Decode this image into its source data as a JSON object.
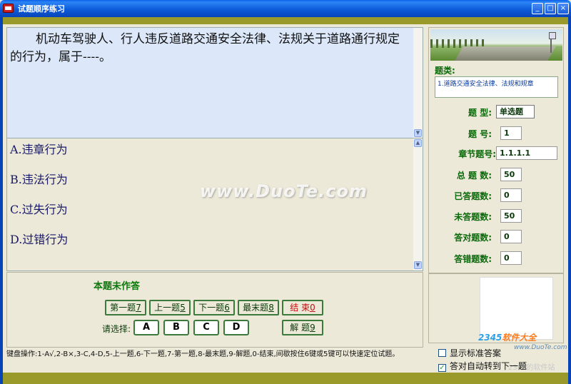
{
  "window": {
    "title": "试题顺序练习"
  },
  "question": {
    "text": "机动车驾驶人、行人违反道路交通安全法律、法规关于道路通行规定的行为，属于----。"
  },
  "options": [
    {
      "label": "A.违章行为"
    },
    {
      "label": "B.违法行为"
    },
    {
      "label": "C.过失行为"
    },
    {
      "label": "D.过错行为"
    }
  ],
  "watermark": "www.DuoTe.com",
  "controls": {
    "status": "本题未作答",
    "first": {
      "label": "第一题",
      "key": "7"
    },
    "prev": {
      "label": "上一题",
      "key": "5"
    },
    "next": {
      "label": "下一题",
      "key": "6"
    },
    "last": {
      "label": "最末题",
      "key": "8"
    },
    "end": {
      "label": "结  束",
      "key": "0"
    },
    "select_label": "请选择:",
    "choices": [
      "A",
      "B",
      "C",
      "D"
    ],
    "solve": {
      "label": "解  题",
      "key": "9"
    }
  },
  "help_text": "键盘操作:1-A√,2-B×,3-C,4-D,5-上一题,6-下一题,7-第一题,8-最末题,9-解题,0-结束,间歇按住6键或5键可以快速定位试题。",
  "info": {
    "category_label": "题类:",
    "category_value": "1.道路交通安全法律、法规和规章",
    "fields": [
      {
        "label": "题  型:",
        "value": "单选题"
      },
      {
        "label": "题  号:",
        "value": "1"
      },
      {
        "label": "章节题号:",
        "value": "1.1.1.1"
      },
      {
        "label": "总 题 数:",
        "value": "50"
      },
      {
        "label": "已答题数:",
        "value": "0"
      },
      {
        "label": "未答题数:",
        "value": "50"
      },
      {
        "label": "答对题数:",
        "value": "0"
      },
      {
        "label": "答错题数:",
        "value": "0"
      }
    ]
  },
  "settings": {
    "show_answer": {
      "label": "显示标准答案",
      "checked": false
    },
    "auto_next": {
      "label": "答对自动转到下一题",
      "checked": true
    }
  },
  "branding": {
    "logo_prefix": "2345",
    "logo_suffix": "软件大全",
    "url": "www.DuoTe.com",
    "cn": "2345的软件站"
  },
  "colors": {
    "titlebar": "#0a5ee6",
    "stripe": "#9a9a2a",
    "question_bg": "#dce8fa",
    "accent_green": "#0a6a0a"
  }
}
